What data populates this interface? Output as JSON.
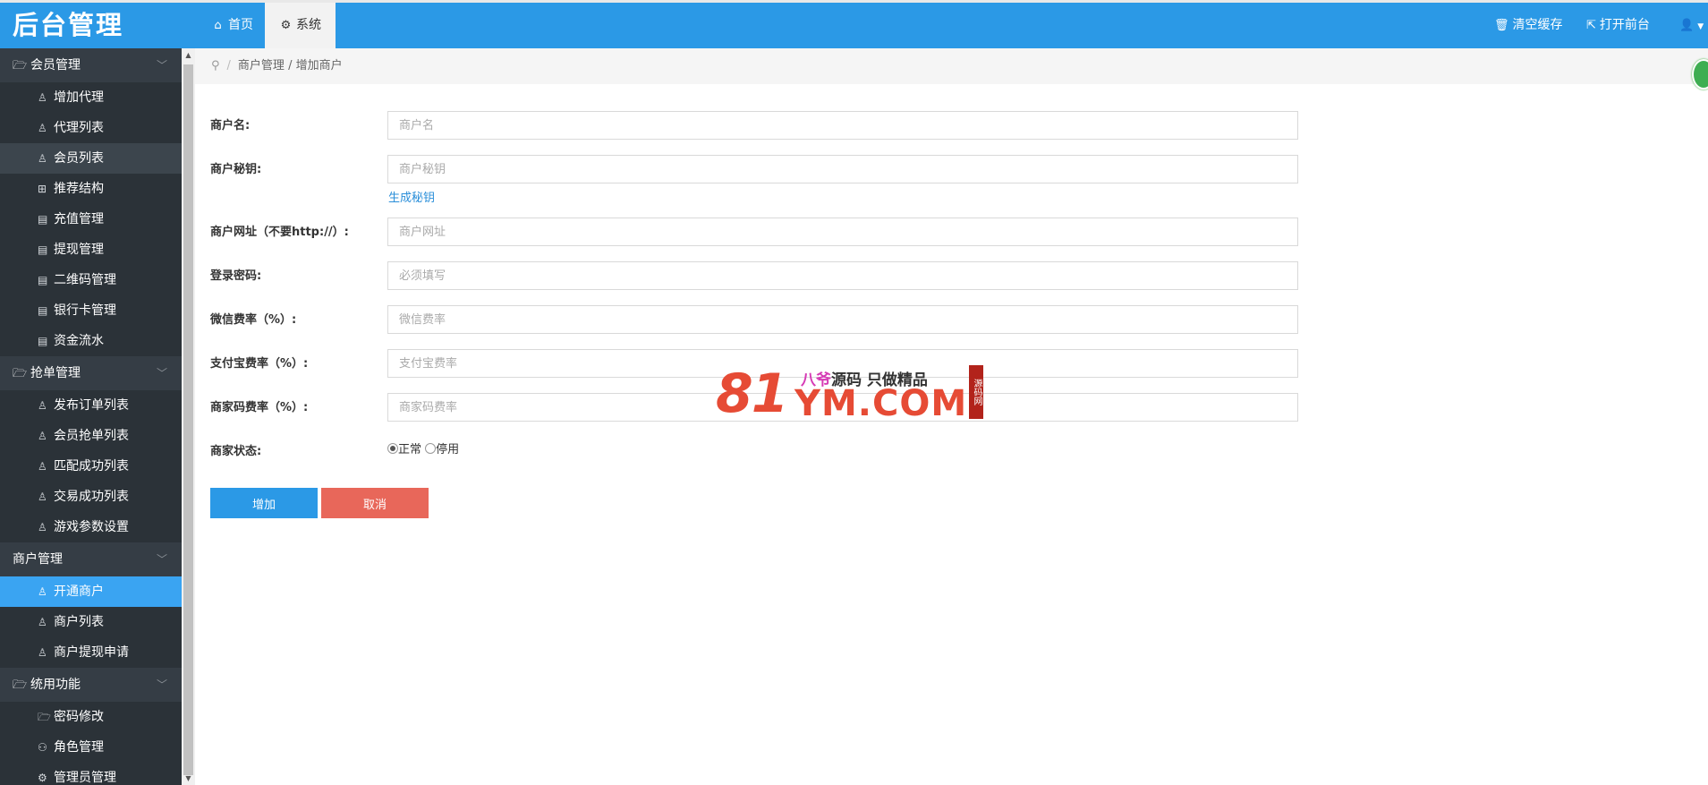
{
  "app": {
    "title": "后台管理"
  },
  "header": {
    "tabs": [
      {
        "label": "首页",
        "icon": "home-icon"
      },
      {
        "label": "系统",
        "icon": "gear-icon"
      }
    ],
    "right": {
      "clear_cache": "清空缓存",
      "open_front": "打开前台"
    }
  },
  "sidebar": {
    "groups": [
      {
        "label": "会员管理",
        "items": [
          "增加代理",
          "代理列表",
          "会员列表",
          "推荐结构",
          "充值管理",
          "提现管理",
          "二维码管理",
          "银行卡管理",
          "资金流水"
        ]
      },
      {
        "label": "抢单管理",
        "items": [
          "发布订单列表",
          "会员抢单列表",
          "匹配成功列表",
          "交易成功列表",
          "游戏参数设置"
        ]
      },
      {
        "label": "商户管理",
        "items": [
          "开通商户",
          "商户列表",
          "商户提现申请"
        ]
      },
      {
        "label": "统用功能",
        "items": [
          "密码修改",
          "角色管理",
          "管理员管理"
        ]
      }
    ],
    "active_item": "开通商户",
    "hover_item": "会员列表"
  },
  "breadcrumb": {
    "parent": "商户管理",
    "separator": "/",
    "current": "增加商户"
  },
  "form": {
    "merchant_name": {
      "label": "商户名:",
      "placeholder": "商户名"
    },
    "merchant_key": {
      "label": "商户秘钥:",
      "placeholder": "商户秘钥",
      "generate_link": "生成秘钥"
    },
    "merchant_url": {
      "label": "商户网址（不要http://）:",
      "placeholder": "商户网址"
    },
    "login_password": {
      "label": "登录密码:",
      "placeholder": "必须填写"
    },
    "wechat_rate": {
      "label": "微信费率（%）:",
      "placeholder": "微信费率"
    },
    "alipay_rate": {
      "label": "支付宝费率（%）:",
      "placeholder": "支付宝费率"
    },
    "merchant_code_rate": {
      "label": "商家码费率（%）:",
      "placeholder": "商家码费率"
    },
    "status": {
      "label": "商家状态:",
      "options": [
        "正常",
        "停用"
      ],
      "selected": "正常"
    },
    "buttons": {
      "add": "增加",
      "cancel": "取消"
    }
  },
  "watermark": {
    "number": "81",
    "domain": "YM.COM",
    "slogan_pink": "八爷",
    "slogan_rest": "源码 只做精品",
    "stamp": "源码网"
  },
  "colors": {
    "header_bg": "#2b99e6",
    "sidebar_bg": "#2b3238",
    "active_item": "#3aa4f2",
    "add_button": "#2b99e6",
    "cancel_button": "#e8675a"
  }
}
